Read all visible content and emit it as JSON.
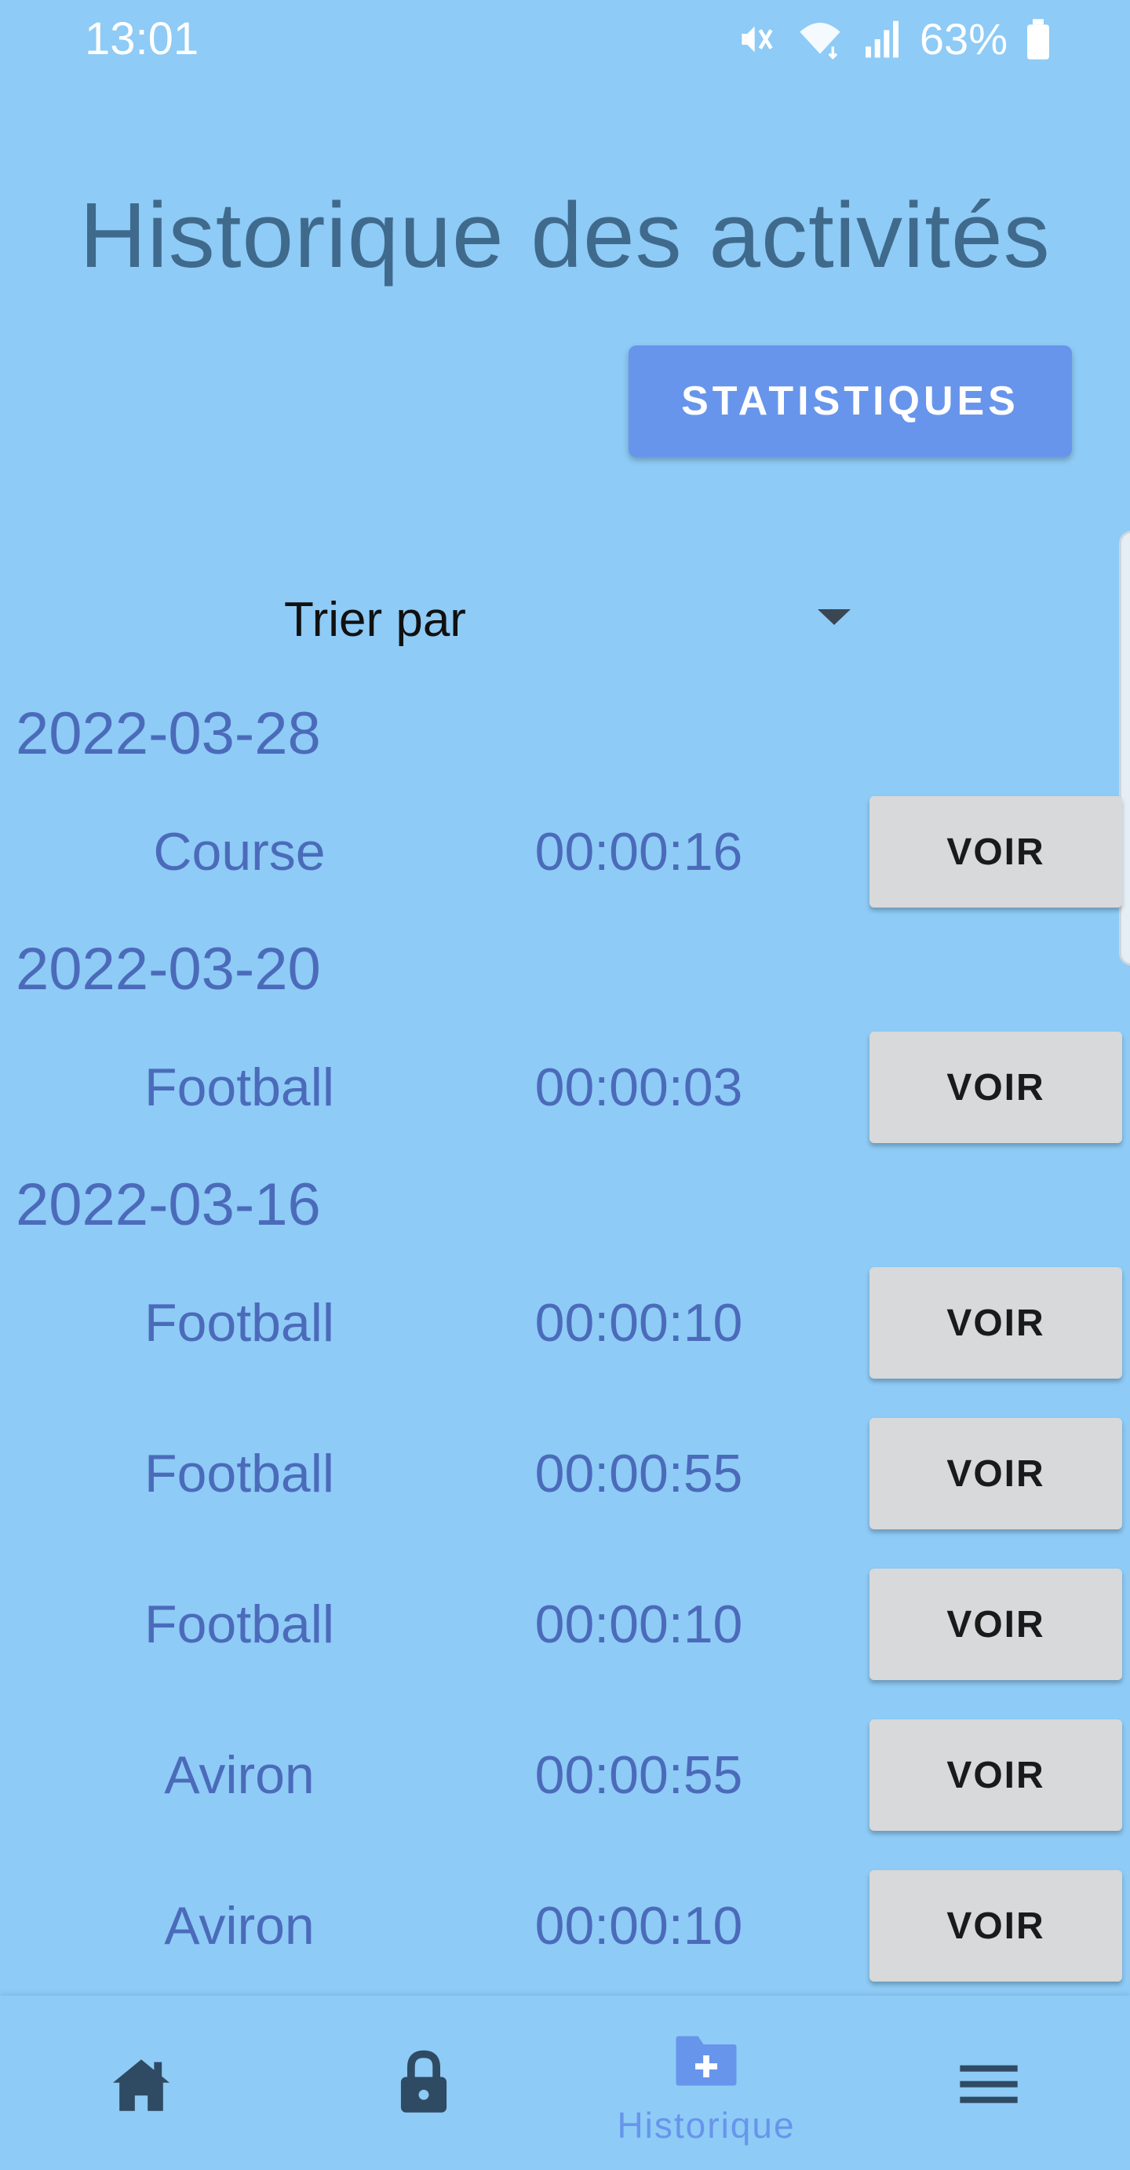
{
  "status_bar": {
    "time": "13:01",
    "battery": "63%",
    "icons": [
      "mute-icon",
      "wifi-icon",
      "signal-icon",
      "battery-icon"
    ]
  },
  "page": {
    "title": "Historique des activités"
  },
  "actions": {
    "stats_label": "STATISTIQUES"
  },
  "sort": {
    "label": "Trier par"
  },
  "groups": [
    {
      "date": "2022-03-28",
      "items": [
        {
          "name": "Course",
          "duration": "00:00:16",
          "button": "VOIR"
        }
      ]
    },
    {
      "date": "2022-03-20",
      "items": [
        {
          "name": "Football",
          "duration": "00:00:03",
          "button": "VOIR"
        }
      ]
    },
    {
      "date": "2022-03-16",
      "items": [
        {
          "name": "Football",
          "duration": "00:00:10",
          "button": "VOIR"
        },
        {
          "name": "Football",
          "duration": "00:00:55",
          "button": "VOIR"
        },
        {
          "name": "Football",
          "duration": "00:00:10",
          "button": "VOIR"
        },
        {
          "name": "Aviron",
          "duration": "00:00:55",
          "button": "VOIR"
        },
        {
          "name": "Aviron",
          "duration": "00:00:10",
          "button": "VOIR"
        }
      ]
    }
  ],
  "nav": {
    "items": [
      {
        "icon": "home-icon",
        "label": ""
      },
      {
        "icon": "lock-icon",
        "label": ""
      },
      {
        "icon": "folder-add-icon",
        "label": "Historique",
        "active": true
      },
      {
        "icon": "menu-icon",
        "label": ""
      }
    ]
  },
  "colors": {
    "background": "#8ecbf6",
    "title": "#3f6a8c",
    "accent": "#6795eb",
    "list_text": "#4b6bba",
    "button_bg": "#d7d9da",
    "nav_icon": "#2f4a63"
  }
}
